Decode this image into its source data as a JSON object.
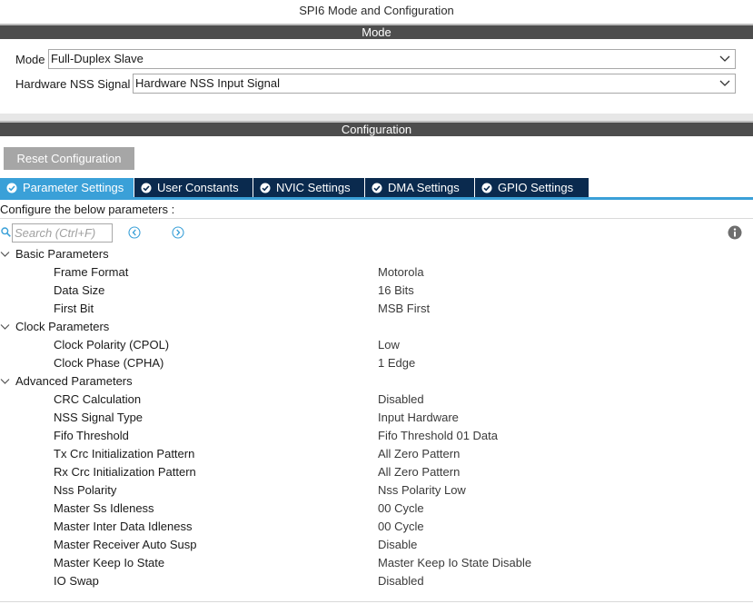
{
  "window": {
    "title": "SPI6 Mode and Configuration"
  },
  "mode_section": {
    "header": "Mode",
    "mode_label": "Mode",
    "mode_value": "Full-Duplex Slave",
    "nss_label": "Hardware NSS Signal",
    "nss_value": "Hardware NSS Input Signal"
  },
  "config_section": {
    "header": "Configuration",
    "reset_button": "Reset Configuration",
    "tabs": [
      {
        "label": "Parameter Settings",
        "active": true
      },
      {
        "label": "User Constants",
        "active": false
      },
      {
        "label": "NVIC Settings",
        "active": false
      },
      {
        "label": "DMA Settings",
        "active": false
      },
      {
        "label": "GPIO Settings",
        "active": false
      }
    ],
    "instructions": "Configure the below parameters :",
    "search": {
      "placeholder": "Search (Ctrl+F)"
    }
  },
  "parameters": {
    "basic": {
      "label": "Basic Parameters",
      "rows": [
        {
          "name": "Frame Format",
          "value": "Motorola"
        },
        {
          "name": "Data Size",
          "value": "16 Bits"
        },
        {
          "name": "First Bit",
          "value": "MSB First"
        }
      ]
    },
    "clock": {
      "label": "Clock Parameters",
      "rows": [
        {
          "name": "Clock Polarity (CPOL)",
          "value": "Low"
        },
        {
          "name": "Clock Phase (CPHA)",
          "value": "1 Edge"
        }
      ]
    },
    "advanced": {
      "label": "Advanced Parameters",
      "rows": [
        {
          "name": "CRC Calculation",
          "value": "Disabled"
        },
        {
          "name": "NSS Signal Type",
          "value": "Input Hardware"
        },
        {
          "name": "Fifo Threshold",
          "value": "Fifo Threshold 01 Data"
        },
        {
          "name": "Tx Crc Initialization Pattern",
          "value": "All Zero Pattern"
        },
        {
          "name": "Rx Crc Initialization Pattern",
          "value": "All Zero Pattern"
        },
        {
          "name": "Nss Polarity",
          "value": "Nss Polarity Low"
        },
        {
          "name": "Master Ss Idleness",
          "value": "00 Cycle"
        },
        {
          "name": "Master Inter Data Idleness",
          "value": "00 Cycle"
        },
        {
          "name": "Master Receiver Auto Susp",
          "value": "Disable"
        },
        {
          "name": "Master Keep Io State",
          "value": "Master Keep Io State Disable"
        },
        {
          "name": "IO Swap",
          "value": "Disabled"
        }
      ]
    }
  },
  "colors": {
    "section_header_bg": "#4d4d4d",
    "tab_bg": "#0a2a4e",
    "tab_active_bg": "#3aa0d8",
    "nav_accent": "#3aa0d8"
  },
  "icons": {
    "dropdown": "chevron-down-icon",
    "tab_status": "check-circle-icon",
    "search": "search-icon",
    "prev": "chevron-left-circle-icon",
    "next": "chevron-right-circle-icon",
    "info": "info-icon",
    "group_toggle": "chevron-down-icon"
  }
}
